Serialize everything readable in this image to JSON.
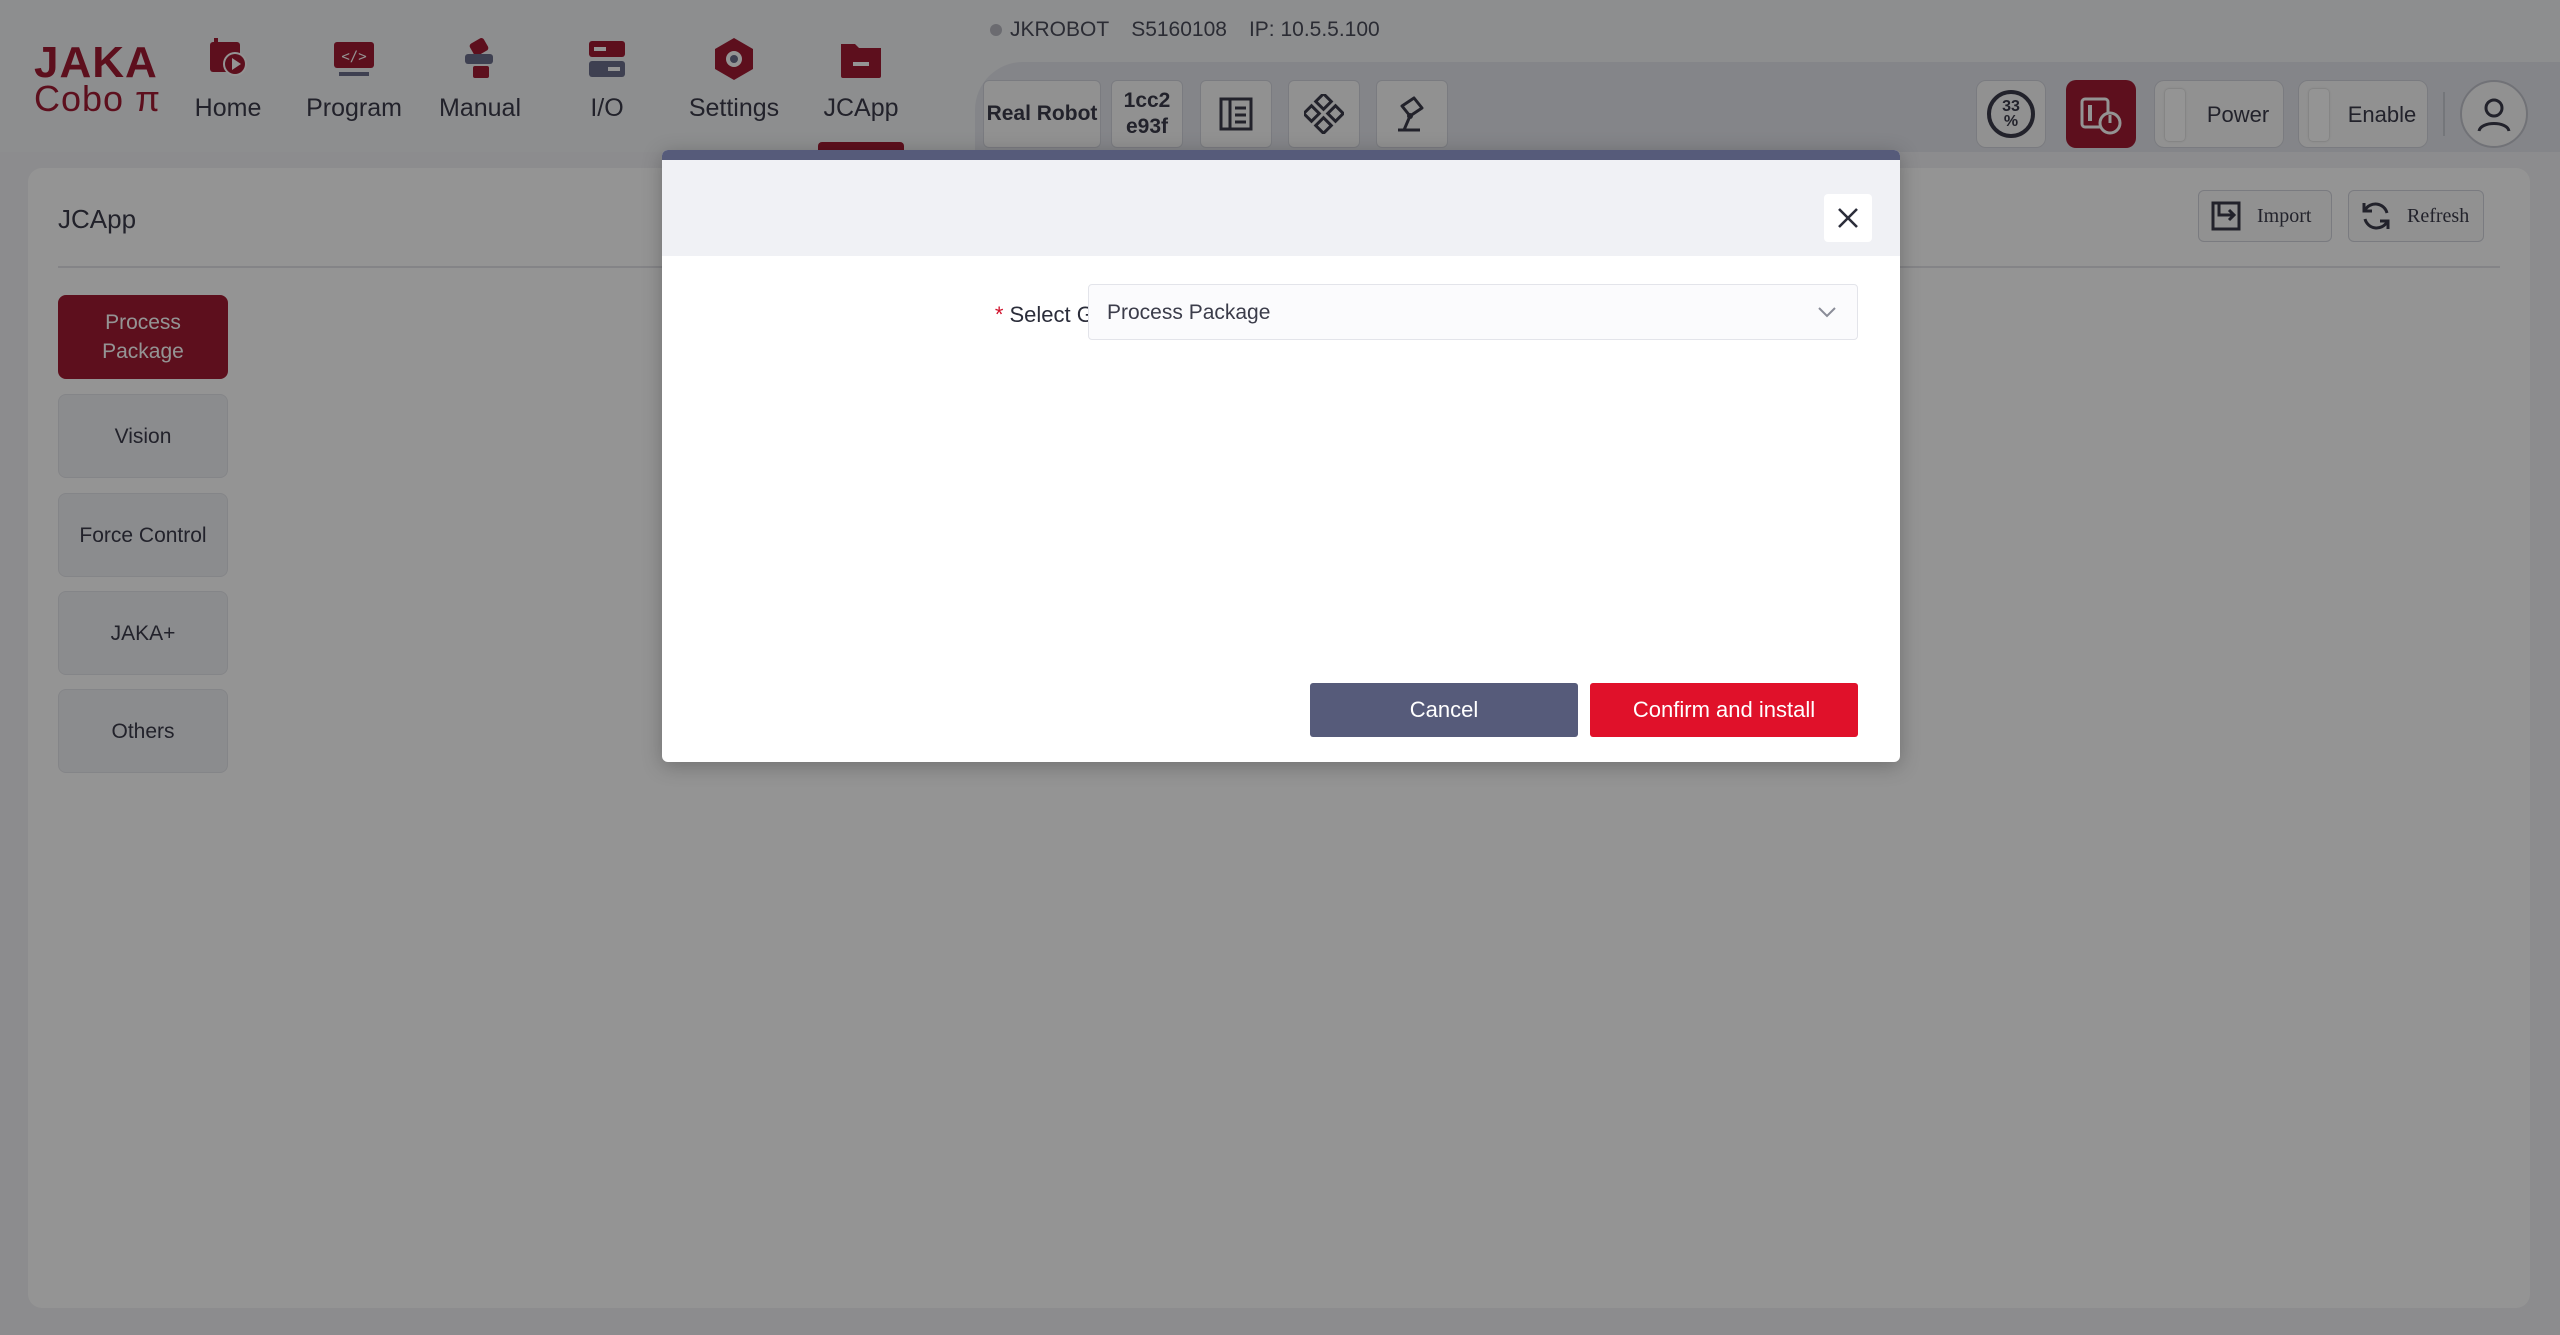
{
  "brand": {
    "line1": "JAKA",
    "line2": "Cobo π"
  },
  "nav": [
    {
      "label": "Home",
      "icon": "home-icon"
    },
    {
      "label": "Program",
      "icon": "program-icon"
    },
    {
      "label": "Manual",
      "icon": "manual-icon"
    },
    {
      "label": "I/O",
      "icon": "io-icon"
    },
    {
      "label": "Settings",
      "icon": "settings-icon"
    },
    {
      "label": "JCApp",
      "icon": "jcapp-icon",
      "active": true
    }
  ],
  "status": {
    "robot": "JKROBOT",
    "serial": "S5160108",
    "ip": "IP: 10.5.5.100"
  },
  "toolbar": {
    "real_robot": "Real Robot",
    "id_line1": "1cc2",
    "id_line2": "e93f",
    "icons": [
      "list-panel-icon",
      "diamond-grid-icon",
      "robot-arm-icon"
    ]
  },
  "right_controls": {
    "speed_value": "33",
    "speed_unit": "%",
    "power_label": "Power",
    "enable_label": "Enable"
  },
  "page": {
    "title": "JCApp",
    "import_label": "Import",
    "refresh_label": "Refresh",
    "sidebar": [
      {
        "label": "Process Package",
        "active": true
      },
      {
        "label": "Vision"
      },
      {
        "label": "Force Control"
      },
      {
        "label": "JAKA+"
      },
      {
        "label": "Others"
      }
    ]
  },
  "dialog": {
    "field_label": "Select Group",
    "field_colon": ":",
    "required_mark": "*",
    "selected_value": "Process Package",
    "cancel_label": "Cancel",
    "confirm_label": "Confirm and install"
  },
  "colors": {
    "brand": "#a11b32",
    "dialog_accent": "#565b7a",
    "confirm": "#e0112a"
  }
}
